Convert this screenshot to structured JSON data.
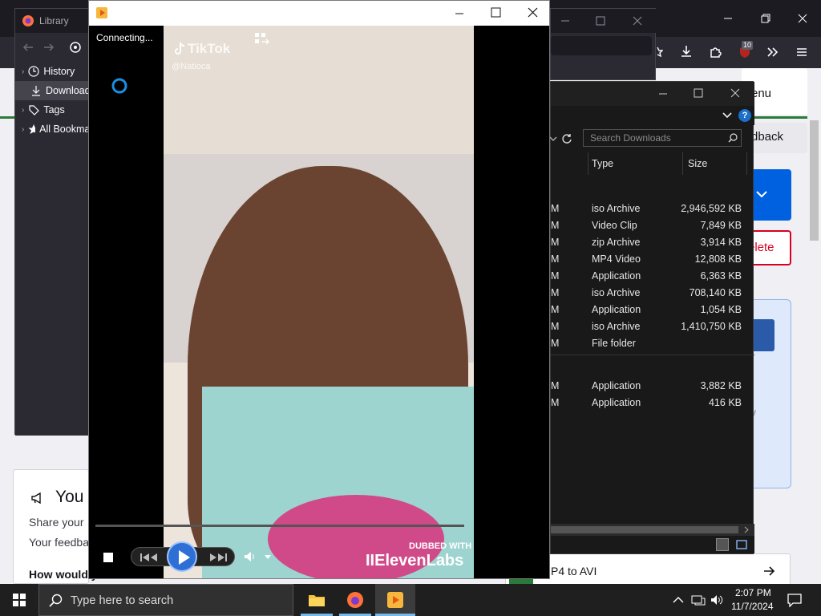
{
  "browser": {
    "content": {
      "card_header_partial": "enu",
      "feedback_partial": "dback",
      "delete_partial": "elete",
      "faded_partial": "y",
      "convert_partial": "P4 to AVI",
      "section_title_partial": "You",
      "share_line": "Share your",
      "feedback_line": "Your feedba",
      "question_line": "How would you r"
    }
  },
  "library": {
    "title": "Library",
    "tree": [
      {
        "label": "History",
        "icon": "clock-icon"
      },
      {
        "label": "Downloads",
        "icon": "download-icon"
      },
      {
        "label": "Tags",
        "icon": "tag-icon"
      },
      {
        "label": "All Bookmarks",
        "icon": "star-icon"
      }
    ]
  },
  "explorer": {
    "search_placeholder": "Search Downloads",
    "columns": {
      "type": "Type",
      "size": "Size"
    },
    "rows": [
      {
        "date_partial": "M",
        "type": "iso Archive",
        "size": "2,946,592 KB"
      },
      {
        "date_partial": "M",
        "type": "Video Clip",
        "size": "7,849 KB"
      },
      {
        "date_partial": "M",
        "type": "zip Archive",
        "size": "3,914 KB"
      },
      {
        "date_partial": "M",
        "type": "MP4 Video",
        "size": "12,808 KB"
      },
      {
        "date_partial": "M",
        "type": "Application",
        "size": "6,363 KB"
      },
      {
        "date_partial": "M",
        "type": "iso Archive",
        "size": "708,140 KB"
      },
      {
        "date_partial": "M",
        "type": "Application",
        "size": "1,054 KB"
      },
      {
        "date_partial": "M",
        "type": "iso Archive",
        "size": "1,410,750 KB"
      },
      {
        "date_partial": "M",
        "type": "File folder",
        "size": ""
      },
      {
        "date_partial": "M",
        "type": "Application",
        "size": "3,882 KB"
      },
      {
        "date_partial": "M",
        "type": "Application",
        "size": "416 KB"
      }
    ]
  },
  "player": {
    "status": "Connecting...",
    "overlay": {
      "tiktok": "TikTok",
      "handle": "@Natioca",
      "dubbed": "DUBBED WITH",
      "brand": "IIElevenLabs"
    },
    "colors": {
      "spinner": "#1a8fe3",
      "play": "#2e6fd6"
    }
  },
  "taskbar": {
    "search_placeholder": "Type here to search",
    "time": "2:07 PM",
    "date": "11/7/2024",
    "badge": "10"
  }
}
